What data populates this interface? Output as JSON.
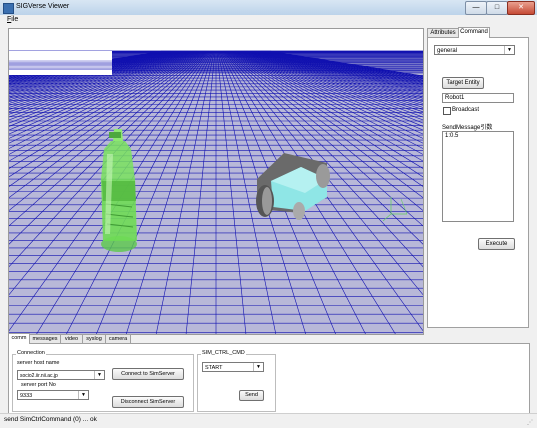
{
  "window": {
    "title": "SIGVerse Viewer",
    "min_glyph": "—",
    "max_glyph": "□",
    "close_glyph": "✕"
  },
  "menu": {
    "file_underlined": "F",
    "file_rest": "ile"
  },
  "right_panel": {
    "tabs": [
      "Attributes",
      "Command"
    ],
    "active_tab": "Command",
    "command_select": {
      "value": "general"
    },
    "target_entity_button": "Target Entity",
    "target_entity_value": "Robot1",
    "broadcast_label": "Broadcast",
    "broadcast_checked": false,
    "send_message_label": "SendMessage引数",
    "send_message_value": "1:0.5",
    "execute_button": "Execute"
  },
  "bottom_panel": {
    "tabs": [
      "comm",
      "messages",
      "video",
      "syslog",
      "camera"
    ],
    "active_tab": "comm",
    "connection_group_label": "Connection",
    "server_host_label": "server host name",
    "server_host_value": "socio2.iir.nii.ac.jp",
    "server_port_label": "server port No",
    "server_port_value": "9333",
    "connect_button": "Connect to SimServer",
    "disconnect_button": "Disconnect SimServer",
    "sim_ctrl_group_label": "SIM_CTRL_CMD",
    "sim_ctrl_value": "START",
    "send_button": "Send"
  },
  "status_bar": {
    "text": "send SimCtrlCommand (0) ... ok"
  },
  "icons": {
    "dropdown": "chevron-down-icon",
    "app": "app-icon"
  },
  "colors": {
    "sky": "#ffffff",
    "floor": "#b8b8d8",
    "grid": "#1010b0",
    "bottle": "#6fdc55",
    "robot_body": "#8fe6e6"
  }
}
